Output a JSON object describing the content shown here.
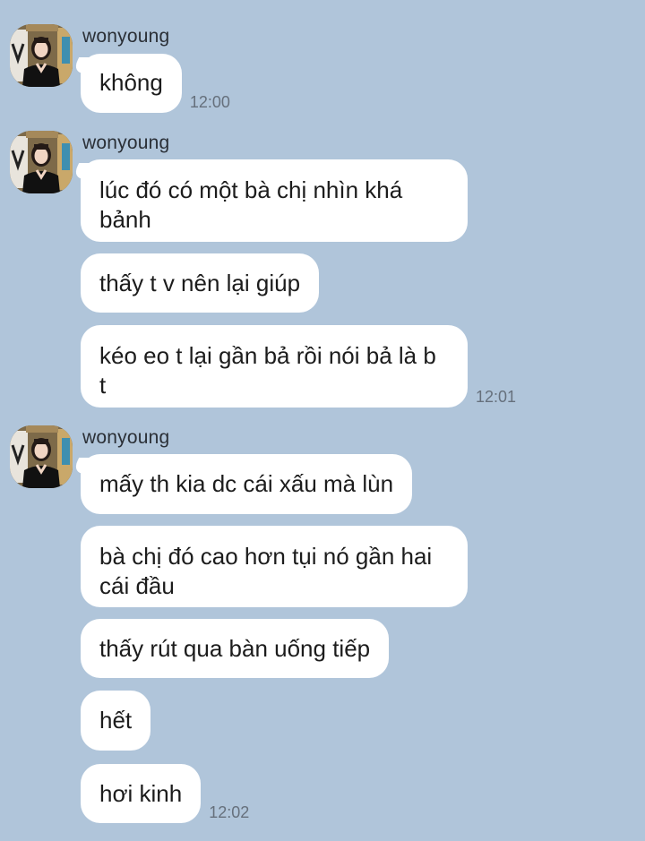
{
  "chat": {
    "groups": [
      {
        "sender": "wonyoung",
        "messages": [
          {
            "text": "không",
            "time": "12:00"
          }
        ]
      },
      {
        "sender": "wonyoung",
        "messages": [
          {
            "text": "lúc đó có một bà chị nhìn khá bảnh",
            "time": ""
          },
          {
            "text": "thấy t v nên lại giúp",
            "time": ""
          },
          {
            "text": "kéo eo t lại gần bả rồi nói bả là b t",
            "time": "12:01"
          }
        ]
      },
      {
        "sender": "wonyoung",
        "messages": [
          {
            "text": "mấy th kia dc cái xấu mà lùn",
            "time": ""
          },
          {
            "text": "bà chị đó cao hơn tụi nó gần hai cái đầu",
            "time": ""
          },
          {
            "text": "thấy rút qua bàn uống tiếp",
            "time": ""
          },
          {
            "text": "hết",
            "time": ""
          },
          {
            "text": "hơi kinh",
            "time": "12:02"
          }
        ]
      }
    ]
  },
  "colors": {
    "background": "#b0c5da",
    "bubble": "#ffffff",
    "time_text": "#66707c"
  },
  "icons": {
    "avatar": "profile-photo"
  }
}
